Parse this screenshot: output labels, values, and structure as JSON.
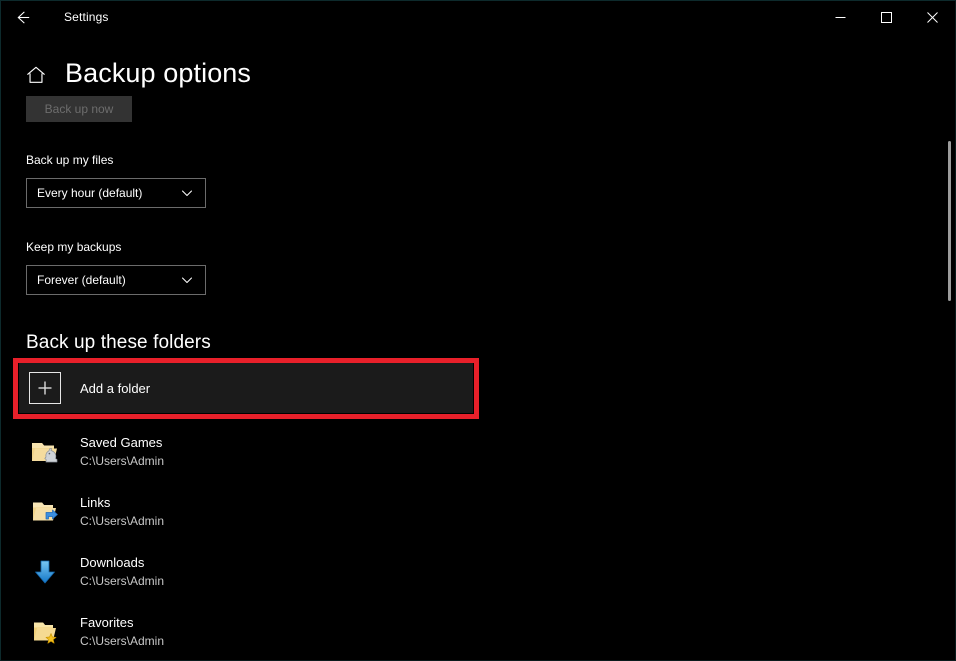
{
  "window": {
    "titlebar_title": "Settings",
    "back_icon": "back-arrow-icon",
    "minimize_label": "─",
    "maximize_label": "□",
    "close_label": "✕"
  },
  "header": {
    "home_icon": "home-icon",
    "page_title": "Backup options"
  },
  "actions": {
    "backup_now_label": "Back up now",
    "backup_now_disabled": true
  },
  "fields": [
    {
      "label": "Back up my files",
      "value": "Every hour (default)",
      "icon": "chevron-down-icon"
    },
    {
      "label": "Keep my backups",
      "value": "Forever (default)",
      "icon": "chevron-down-icon"
    }
  ],
  "folders_section": {
    "heading": "Back up these folders",
    "add_folder": {
      "label": "Add a folder",
      "icon": "plus-icon",
      "highlighted": true
    },
    "items": [
      {
        "name": "Saved Games",
        "path": "C:\\Users\\Admin",
        "icon": "folder-saved-games-icon"
      },
      {
        "name": "Links",
        "path": "C:\\Users\\Admin",
        "icon": "folder-shortcut-icon"
      },
      {
        "name": "Downloads",
        "path": "C:\\Users\\Admin",
        "icon": "downloads-arrow-icon"
      },
      {
        "name": "Favorites",
        "path": "C:\\Users\\Admin",
        "icon": "folder-favorites-icon"
      }
    ]
  },
  "colors": {
    "background": "#000000",
    "annotation_red": "#e8202a",
    "row_background": "#1b1b1b",
    "disabled_button_bg": "#333333",
    "disabled_button_text": "#6d6d6d",
    "combobox_border": "#6b6b6b",
    "secondary_text": "#c8c8c8",
    "scrollbar_thumb": "#9c9c9c"
  }
}
